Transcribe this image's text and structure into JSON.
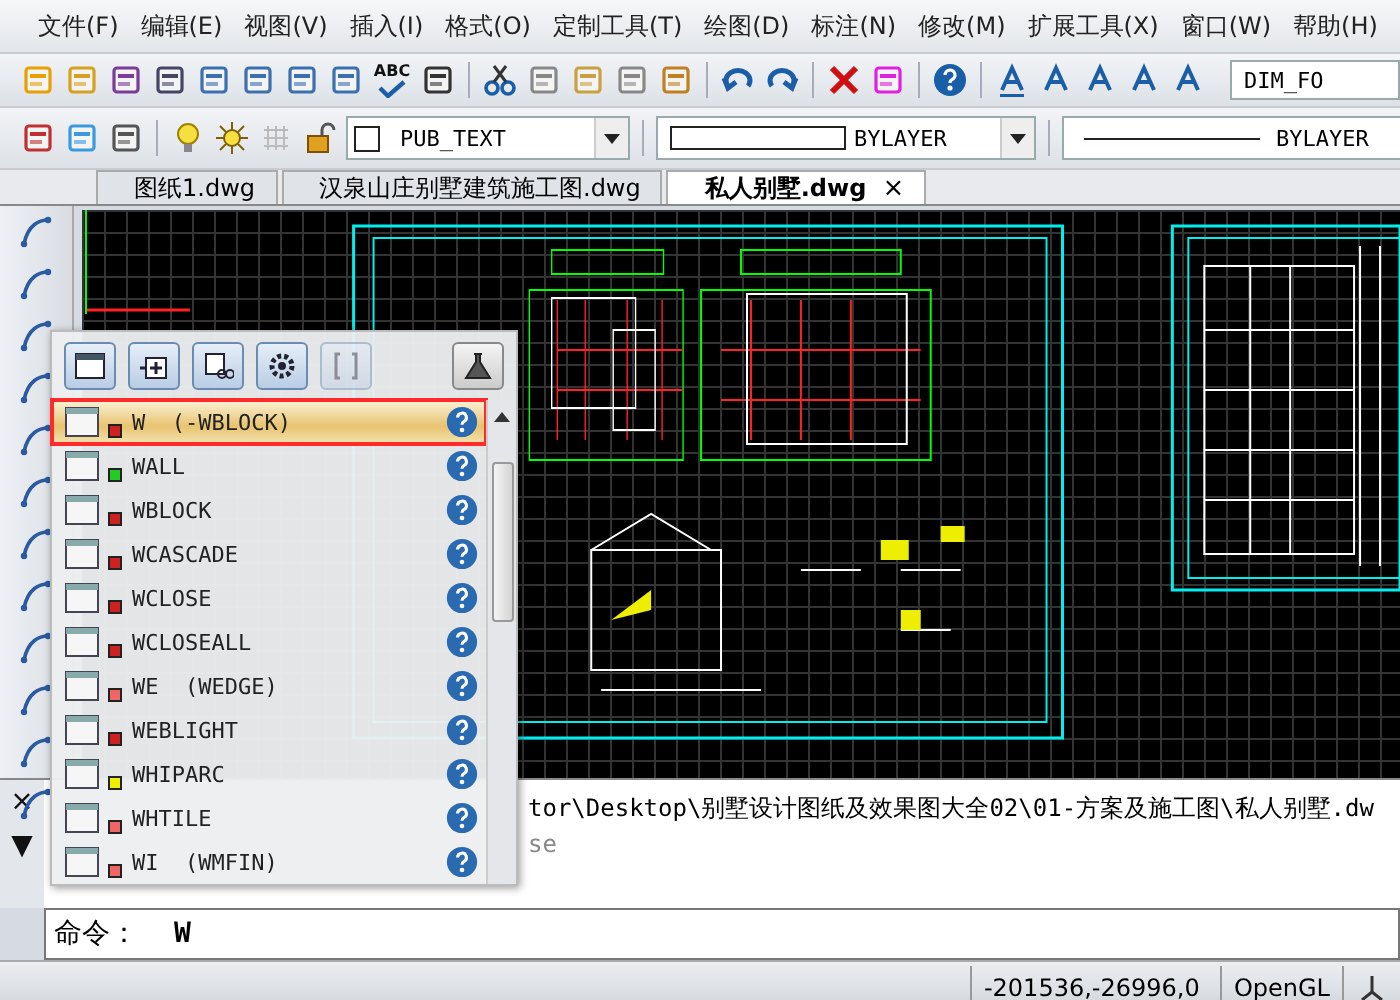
{
  "menu": [
    "文件(F)",
    "编辑(E)",
    "视图(V)",
    "插入(I)",
    "格式(O)",
    "定制工具(T)",
    "绘图(D)",
    "标注(N)",
    "修改(M)",
    "扩展工具(X)",
    "窗口(W)",
    "帮助(H)"
  ],
  "toolbar": {
    "spell_label": "ABC",
    "text_style": "DIM_FO"
  },
  "layer_bar": {
    "layer": "PUB_TEXT",
    "color_setting": "BYLAYER",
    "linetype": "BYLAYER"
  },
  "tabs": [
    {
      "label": "图纸1.dwg",
      "selected": false
    },
    {
      "label": "汉泉山庄别墅建筑施工图.dwg",
      "selected": false
    },
    {
      "label": "私人别墅.dwg",
      "selected": true,
      "close": "×"
    }
  ],
  "command_popup": {
    "items": [
      {
        "name": "W  (-WBLOCK)",
        "color": "#cc2222",
        "selected": true
      },
      {
        "name": "WALL",
        "color": "#22cc22",
        "selected": false
      },
      {
        "name": "WBLOCK",
        "color": "#cc2222",
        "selected": false
      },
      {
        "name": "WCASCADE",
        "color": "#cc2222",
        "selected": false
      },
      {
        "name": "WCLOSE",
        "color": "#cc2222",
        "selected": false
      },
      {
        "name": "WCLOSEALL",
        "color": "#cc2222",
        "selected": false
      },
      {
        "name": "WE  (WEDGE)",
        "color": "#ee6666",
        "selected": false
      },
      {
        "name": "WEBLIGHT",
        "color": "#cc2222",
        "selected": false
      },
      {
        "name": "WHIPARC",
        "color": "#eeee00",
        "selected": false
      },
      {
        "name": "WHTILE",
        "color": "#ee6666",
        "selected": false
      },
      {
        "name": "WI  (WMFIN)",
        "color": "#ee6666",
        "selected": false
      }
    ]
  },
  "command_history": {
    "lines": [
      "tor\\Desktop\\别墅设计图纸及效果图大全02\\01-方案及施工图\\私人别墅.dw",
      "se"
    ],
    "close": "×",
    "expand": "▼"
  },
  "command_line": {
    "prompt": "命令：",
    "value": "W"
  },
  "status_bar": {
    "coordinates": "-201536,-26996,0",
    "renderer": "OpenGL"
  }
}
